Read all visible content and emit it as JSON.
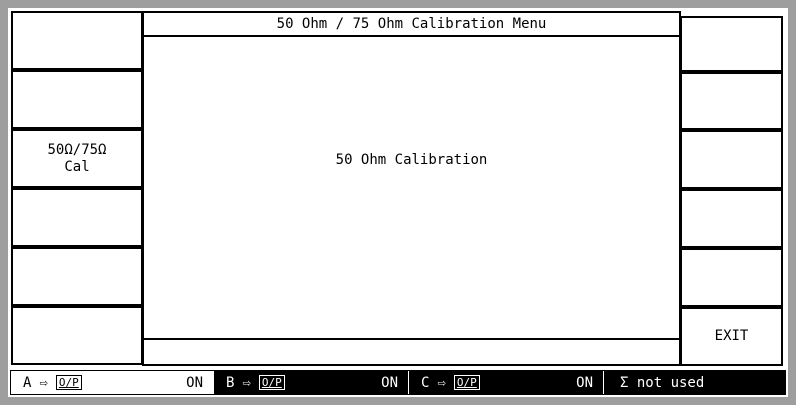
{
  "menu": {
    "title": "50 Ohm / 75 Ohm Calibration Menu",
    "message": "50 Ohm Calibration",
    "status": ""
  },
  "softkeys_left": [
    {
      "line1": "",
      "line2": ""
    },
    {
      "line1": "",
      "line2": ""
    },
    {
      "line1": "50Ω/75Ω",
      "line2": "Cal"
    },
    {
      "line1": "",
      "line2": ""
    },
    {
      "line1": "",
      "line2": ""
    },
    {
      "line1": "",
      "line2": ""
    }
  ],
  "softkeys_right": [
    {
      "label": ""
    },
    {
      "label": ""
    },
    {
      "label": ""
    },
    {
      "label": ""
    },
    {
      "label": ""
    },
    {
      "label": "EXIT"
    }
  ],
  "channels": [
    {
      "name": "A",
      "arrow": "⇨",
      "output": "O/P",
      "state": "ON"
    },
    {
      "name": "B",
      "arrow": "⇨",
      "output": "O/P",
      "state": "ON"
    },
    {
      "name": "C",
      "arrow": "⇨",
      "output": "O/P",
      "state": "ON"
    }
  ],
  "sum": {
    "label": "Σ not used"
  }
}
